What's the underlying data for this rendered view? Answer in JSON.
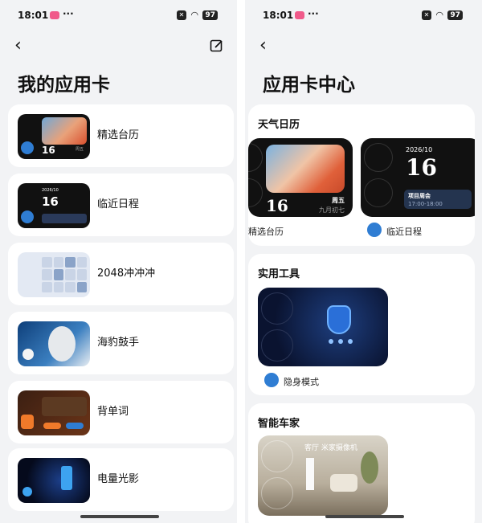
{
  "status": {
    "time": "18:01",
    "dots": "···",
    "battery": "97"
  },
  "left": {
    "title": "我的应用卡",
    "items": [
      {
        "label": "精选台历",
        "thumb_num": "16",
        "thumb_week": "周五"
      },
      {
        "label": "临近日程",
        "thumb_date": "2026/10",
        "thumb_num": "16"
      },
      {
        "label": "2048冲冲冲"
      },
      {
        "label": "海豹鼓手"
      },
      {
        "label": "背单词"
      },
      {
        "label": "电量光影"
      }
    ]
  },
  "right": {
    "title": "应用卡中心",
    "weather": {
      "title": "天气日历",
      "cal": {
        "num": "16",
        "week": "周五",
        "lunar": "九月初七",
        "caption": "精选台历"
      },
      "sch": {
        "date": "2026/10",
        "num": "16",
        "event": "项目周会",
        "time": "17:00-18:00",
        "caption": "临近日程"
      }
    },
    "tools": {
      "title": "实用工具",
      "caption": "隐身模式"
    },
    "car": {
      "title": "智能车家",
      "overlay": "客厅  米家摄像机"
    }
  }
}
